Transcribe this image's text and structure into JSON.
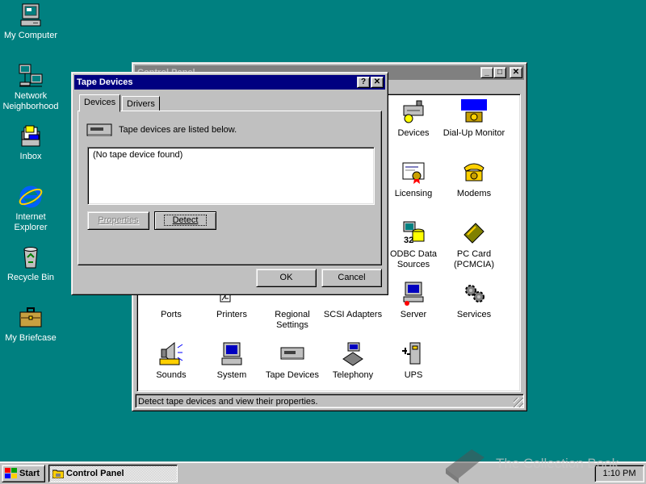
{
  "desktop": {
    "icons": [
      {
        "label": "My Computer"
      },
      {
        "label": "Network Neighborhood"
      },
      {
        "label": "Inbox"
      },
      {
        "label": "Internet Explorer"
      },
      {
        "label": "Recycle Bin"
      },
      {
        "label": "My Briefcase"
      }
    ]
  },
  "control_panel": {
    "title": "Control Panel",
    "items": [
      {
        "label": "Devices"
      },
      {
        "label": "Dial-Up Monitor"
      },
      {
        "label": "Licensing"
      },
      {
        "label": "Modems"
      },
      {
        "label": "ODBC Data Sources"
      },
      {
        "label": "PC Card (PCMCIA)"
      },
      {
        "label": "Ports"
      },
      {
        "label": "Printers"
      },
      {
        "label": "Regional Settings"
      },
      {
        "label": "SCSI Adapters"
      },
      {
        "label": "Server"
      },
      {
        "label": "Services"
      },
      {
        "label": "Sounds"
      },
      {
        "label": "System"
      },
      {
        "label": "Tape Devices"
      },
      {
        "label": "Telephony"
      },
      {
        "label": "UPS"
      }
    ],
    "status": "Detect tape devices and view their properties."
  },
  "dialog": {
    "title": "Tape Devices",
    "help_button": "?",
    "close_button": "✕",
    "tabs": [
      {
        "label": "Devices"
      },
      {
        "label": "Drivers"
      }
    ],
    "description": "Tape devices are listed below.",
    "list_items": [
      "(No tape device found)"
    ],
    "properties_button": "Properties",
    "detect_button": "Detect",
    "ok_button": "OK",
    "cancel_button": "Cancel"
  },
  "taskbar": {
    "start_label": "Start",
    "tasks": [
      {
        "label": "Control Panel"
      }
    ],
    "clock": "1:10 PM"
  },
  "watermark": "The Collection Book",
  "colors": {
    "desktop": "#008080",
    "titlebar_active": "#000080",
    "face": "#c0c0c0"
  }
}
